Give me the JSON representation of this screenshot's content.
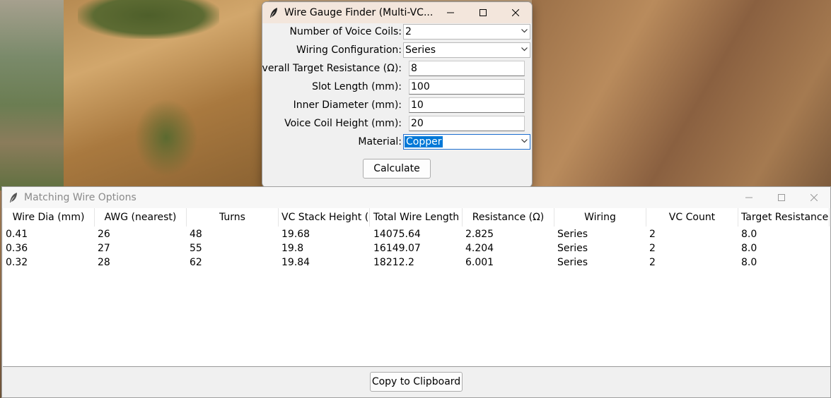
{
  "dialog": {
    "title": "Wire Gauge Finder (Multi-VC...",
    "fields": {
      "num_coils": {
        "label": "Number of Voice Coils:",
        "value": "2"
      },
      "wiring": {
        "label": "Wiring Configuration:",
        "value": "Series"
      },
      "target_res": {
        "label": "Overall Target Resistance (Ω):",
        "value": "8"
      },
      "slot_length": {
        "label": "Slot Length (mm):",
        "value": "100"
      },
      "inner_dia": {
        "label": "Inner Diameter (mm):",
        "value": "10"
      },
      "vc_height": {
        "label": "Voice Coil Height (mm):",
        "value": "20"
      },
      "material": {
        "label": "Material:",
        "value": "Copper"
      }
    },
    "calculate_label": "Calculate"
  },
  "results": {
    "title": "Matching Wire Options",
    "columns": [
      "Wire Dia (mm)",
      "AWG (nearest)",
      "Turns",
      "VC Stack Height (mm)",
      "Total Wire Length",
      "Resistance (Ω)",
      "Wiring",
      "VC Count",
      "Target Resistance (Ω)"
    ],
    "rows": [
      [
        "0.41",
        "26",
        "48",
        "19.68",
        "14075.64",
        "2.825",
        "Series",
        "2",
        "8.0"
      ],
      [
        "0.36",
        "27",
        "55",
        "19.8",
        "16149.07",
        "4.204",
        "Series",
        "2",
        "8.0"
      ],
      [
        "0.32",
        "28",
        "62",
        "19.84",
        "18212.2",
        "6.001",
        "Series",
        "2",
        "8.0"
      ]
    ],
    "copy_label": "Copy to Clipboard"
  },
  "icons": {
    "app": "feather-icon",
    "minimize": "minimize-icon",
    "maximize": "maximize-icon",
    "close": "close-icon",
    "dropdown": "chevron-down-icon"
  },
  "colors": {
    "selection": "#0078d7",
    "dialog_titlebar": "#f3e6dc",
    "window_bg": "#f0f0f0"
  }
}
